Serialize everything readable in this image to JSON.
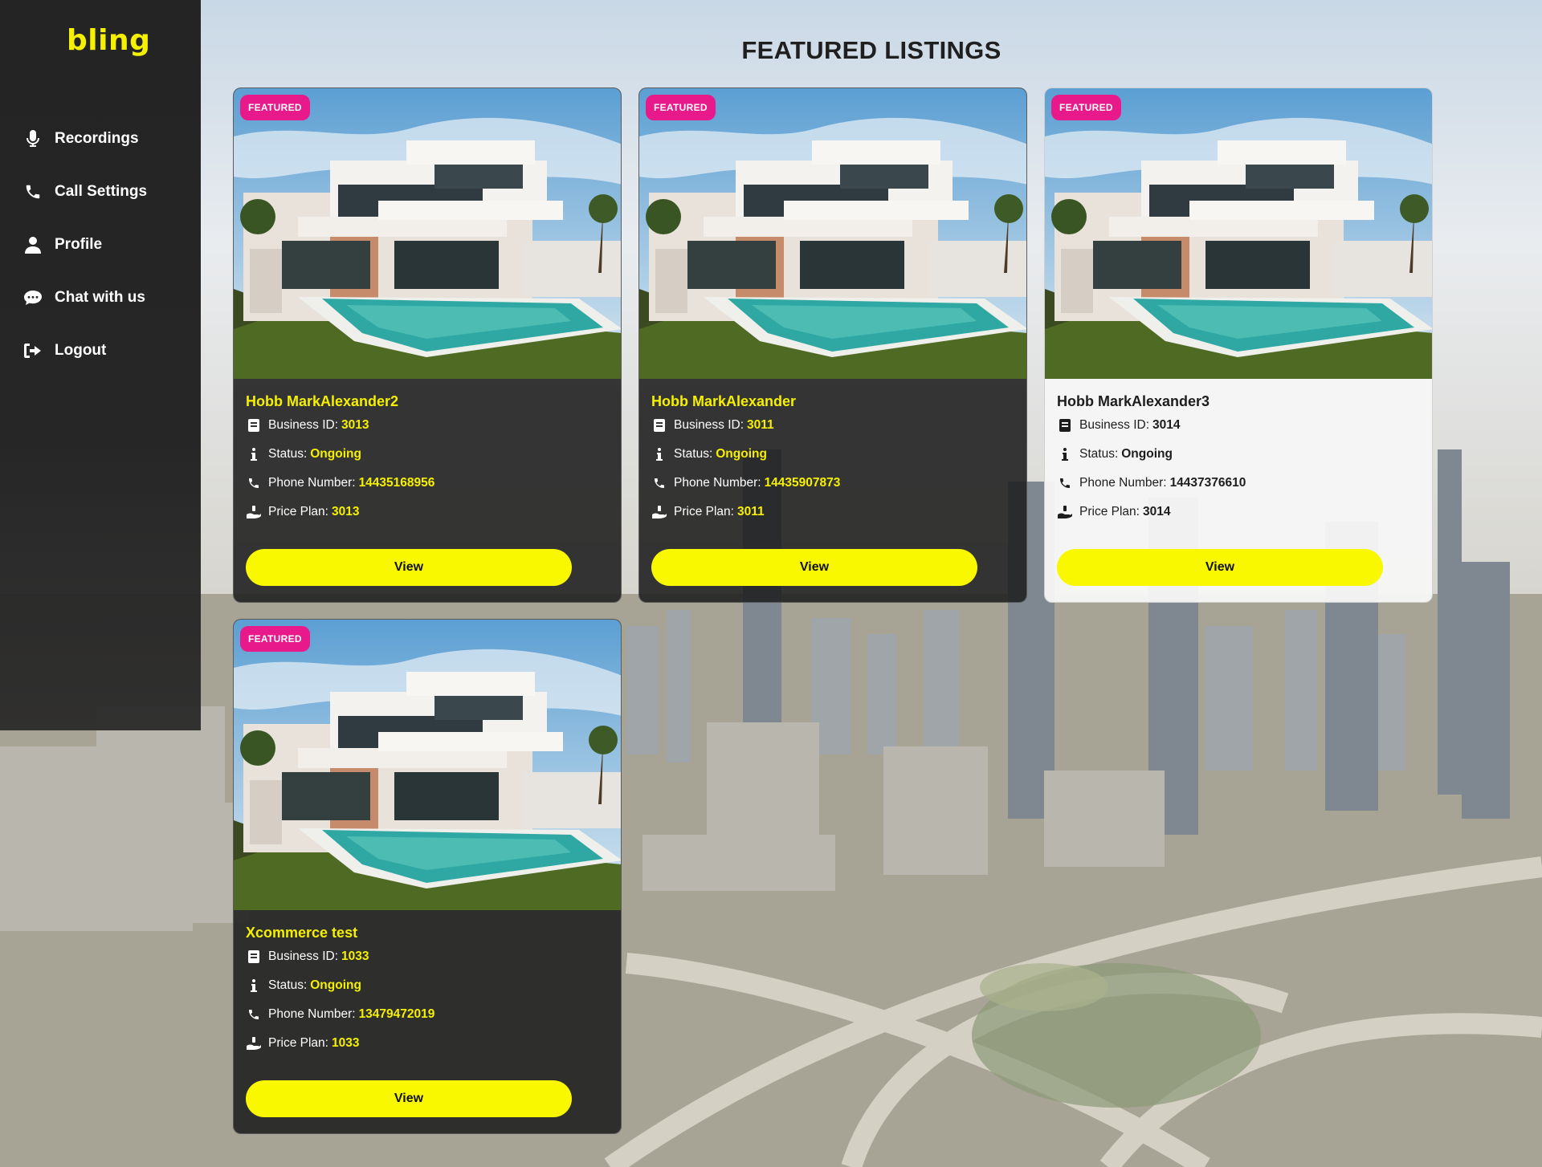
{
  "app": {
    "logo": "bling"
  },
  "sidebar": {
    "items": [
      {
        "label": "Recordings",
        "icon": "microphone-icon"
      },
      {
        "label": "Call Settings",
        "icon": "phone-icon"
      },
      {
        "label": "Profile",
        "icon": "user-icon"
      },
      {
        "label": "Chat with us",
        "icon": "chat-icon"
      },
      {
        "label": "Logout",
        "icon": "logout-icon"
      }
    ]
  },
  "main": {
    "title": "FEATURED LISTINGS",
    "field_labels": {
      "business_id": "Business ID:",
      "status": "Status:",
      "phone": "Phone Number:",
      "price_plan": "Price Plan:"
    },
    "listings": [
      {
        "badge": "FEATURED",
        "name": "Hobb MarkAlexander2",
        "business_id": "3013",
        "status": "Ongoing",
        "phone": "14435168956",
        "price_plan": "3013",
        "button": "View",
        "theme": "dark"
      },
      {
        "badge": "FEATURED",
        "name": "Hobb MarkAlexander",
        "business_id": "3011",
        "status": "Ongoing",
        "phone": "14435907873",
        "price_plan": "3011",
        "button": "View",
        "theme": "dark"
      },
      {
        "badge": "FEATURED",
        "name": "Hobb MarkAlexander3",
        "business_id": "3014",
        "status": "Ongoing",
        "phone": "14437376610",
        "price_plan": "3014",
        "button": "View",
        "theme": "light"
      },
      {
        "badge": "FEATURED",
        "name": "Xcommerce test",
        "business_id": "1033",
        "status": "Ongoing",
        "phone": "13479472019",
        "price_plan": "1033",
        "button": "View",
        "theme": "dark"
      }
    ]
  },
  "colors": {
    "accent": "#f9f800",
    "badge": "#e8198b",
    "sidebar": "#242424"
  }
}
